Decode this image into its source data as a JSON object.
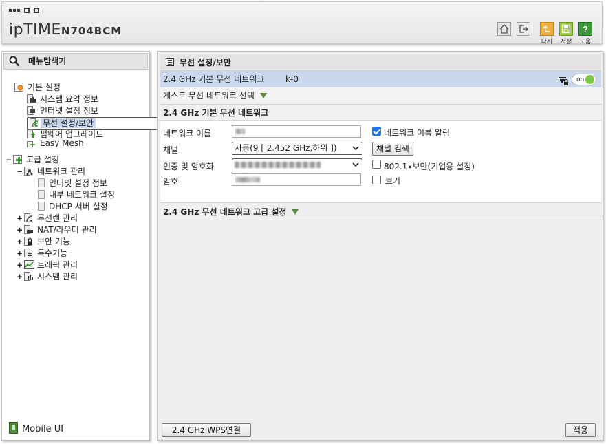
{
  "header": {
    "logo_brand": "ipTIME",
    "logo_model": "N704BCM",
    "buttons": {
      "retry_label": "다시",
      "save_label": "저장",
      "help_label": "도움"
    }
  },
  "sidebar": {
    "title": "메뉴탐색기",
    "basic": {
      "label": "기본 설정",
      "items": [
        "시스템 요약 정보",
        "인터넷 설정 정보",
        "무선 설정/보안",
        "펌웨어 업그레이드",
        "Easy Mesh"
      ],
      "selected_index": 2
    },
    "advanced": {
      "label": "고급 설정",
      "network": {
        "label": "네트워크 관리",
        "children": [
          "인터넷 설정 정보",
          "내부 네트워크 설정",
          "DHCP 서버 설정"
        ]
      },
      "items": [
        "무선랜 관리",
        "NAT/라우터 관리",
        "보안 기능",
        "특수기능",
        "트래픽 관리",
        "시스템 관리"
      ]
    },
    "mobile_ui": "Mobile UI"
  },
  "main": {
    "title": "무선 설정/보안",
    "ssid_row": {
      "label": "2.4 GHz 기본 무선 네트워크",
      "value": "k-0",
      "toggle_text": "on",
      "toggle_on": true
    },
    "guest_label": "게스트 무선 네트워크 선택",
    "basic_section": {
      "title": "2.4 GHz 기본 무선 네트워크",
      "network_name_label": "네트워크 이름",
      "announce_label": "네트워크 이름 알림",
      "announce_checked": true,
      "channel_label": "채널",
      "channel_value": "자동(9 [ 2.452 GHz,하위 ])",
      "channel_search_button": "채널 검색",
      "auth_label": "인증 및 암호화",
      "enterprise_label": "802.1x보안(기업용 설정)",
      "enterprise_checked": false,
      "password_label": "암호",
      "show_label": "보기",
      "show_checked": false
    },
    "advanced_label": "2.4 GHz 무선 네트워크 고급 설정",
    "wps_button": "2.4 GHz WPS연결",
    "apply_button": "적용"
  }
}
